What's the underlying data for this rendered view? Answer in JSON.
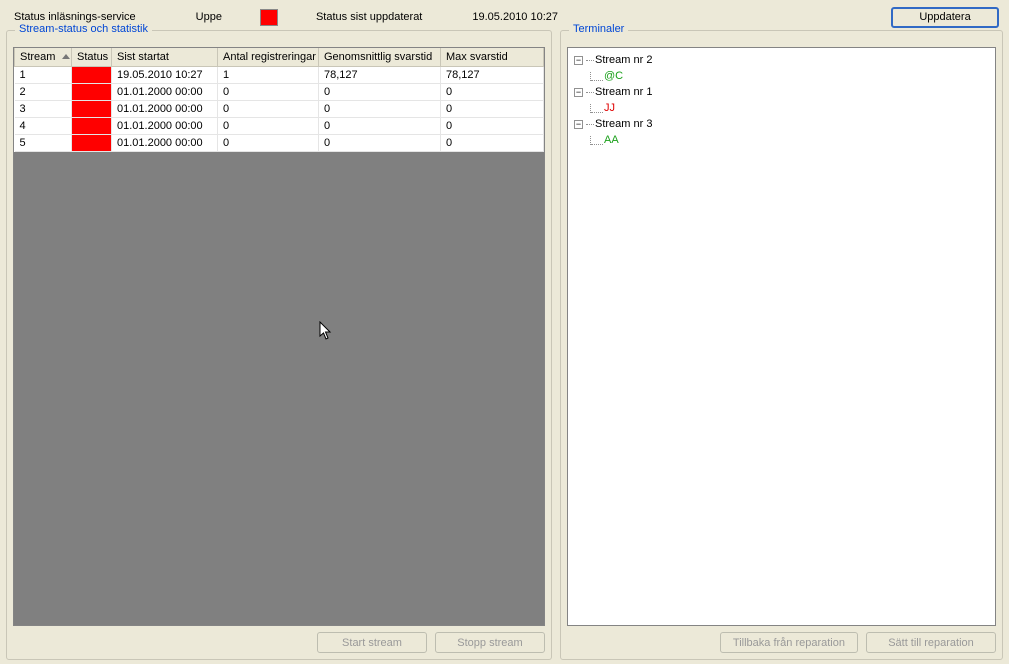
{
  "header": {
    "service_label": "Status inläsnings-service",
    "service_state": "Uppe",
    "updated_label": "Status sist uppdaterat",
    "updated_value": "19.05.2010 10:27",
    "refresh_btn": "Uppdatera"
  },
  "status_color": "#ff0000",
  "left": {
    "title": "Stream-status och statistik",
    "columns": {
      "stream": "Stream",
      "status": "Status",
      "last_started": "Sist startat",
      "registrations": "Antal registreringar",
      "avg_response": "Genomsnittlig svarstid",
      "max_response": "Max svarstid"
    },
    "rows": [
      {
        "stream": "1",
        "last_started": "19.05.2010 10:27",
        "registrations": "1",
        "avg": "78,127",
        "max": "78,127"
      },
      {
        "stream": "2",
        "last_started": "01.01.2000 00:00",
        "registrations": "0",
        "avg": "0",
        "max": "0"
      },
      {
        "stream": "3",
        "last_started": "01.01.2000 00:00",
        "registrations": "0",
        "avg": "0",
        "max": "0"
      },
      {
        "stream": "4",
        "last_started": "01.01.2000 00:00",
        "registrations": "0",
        "avg": "0",
        "max": "0"
      },
      {
        "stream": "5",
        "last_started": "01.01.2000 00:00",
        "registrations": "0",
        "avg": "0",
        "max": "0"
      }
    ],
    "buttons": {
      "start": "Start stream",
      "stop": "Stopp stream"
    }
  },
  "right": {
    "title": "Terminaler",
    "tree": [
      {
        "label": "Stream nr 2",
        "children": [
          {
            "label": "@C",
            "color": "green"
          }
        ]
      },
      {
        "label": "Stream nr 1",
        "children": [
          {
            "label": "JJ",
            "color": "red"
          }
        ]
      },
      {
        "label": "Stream nr 3",
        "children": [
          {
            "label": "AA",
            "color": "green"
          }
        ]
      }
    ],
    "buttons": {
      "back": "Tillbaka från reparation",
      "set": "Sätt till reparation"
    }
  }
}
